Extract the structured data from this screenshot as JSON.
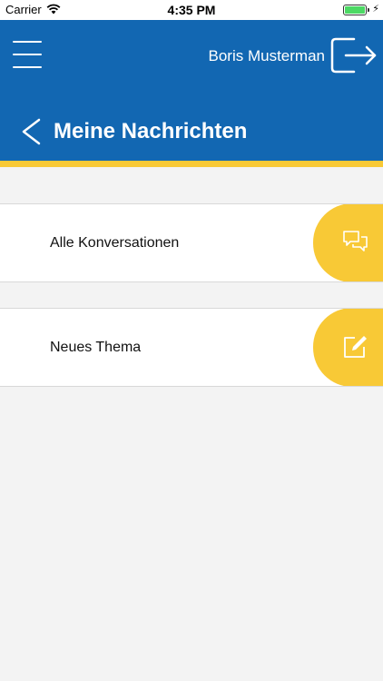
{
  "status_bar": {
    "carrier": "Carrier",
    "time": "4:35 PM",
    "battery_level": 1.0
  },
  "header": {
    "user_name": "Boris Musterman",
    "page_title": "Meine Nachrichten"
  },
  "menu": [
    {
      "label": "Alle Konversationen",
      "icon": "chat-bubbles-icon"
    },
    {
      "label": "Neues Thema",
      "icon": "compose-icon"
    }
  ],
  "colors": {
    "header_blue": "#1267b2",
    "accent_yellow": "#f8c936",
    "background": "#f3f3f3"
  }
}
